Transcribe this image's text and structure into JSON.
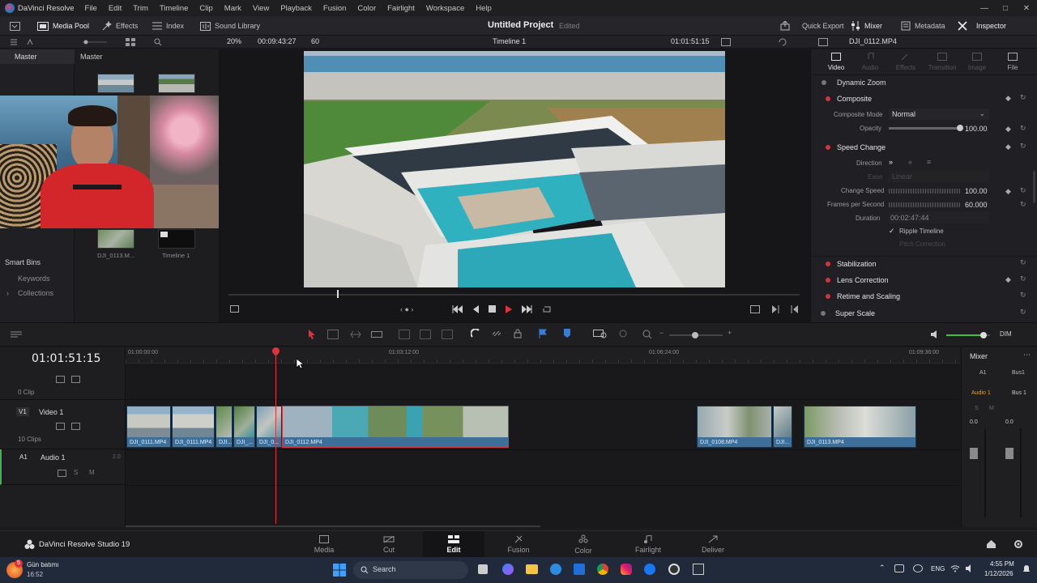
{
  "menubar": {
    "app_name": "DaVinci Resolve",
    "items": [
      "File",
      "Edit",
      "Trim",
      "Timeline",
      "Clip",
      "Mark",
      "View",
      "Playback",
      "Fusion",
      "Color",
      "Fairlight",
      "Workspace",
      "Help"
    ]
  },
  "toolbar": {
    "media_pool": "Media Pool",
    "effects": "Effects",
    "index": "Index",
    "sound_library": "Sound Library",
    "project_title": "Untitled Project",
    "project_status": "Edited",
    "quick_export": "Quick Export",
    "mixer": "Mixer",
    "metadata": "Metadata",
    "inspector": "Inspector"
  },
  "subbar": {
    "zoom": "20%",
    "source_timecode": "00:09:43:27",
    "fps": "60",
    "timeline_name": "Timeline 1",
    "record_timecode": "01:01:51:15",
    "clip_name": "DJI_0112.MP4"
  },
  "media_pool": {
    "bin_master": "Master",
    "header_master": "Master",
    "smart_bins": "Smart Bins",
    "keywords": "Keywords",
    "collections": "Collections",
    "clips": [
      {
        "name": "DJI_0113.M..."
      },
      {
        "name": "Timeline 1"
      }
    ]
  },
  "inspector": {
    "tabs": [
      "Video",
      "Audio",
      "Effects",
      "Transition",
      "Image",
      "File"
    ],
    "dynamic_zoom": "Dynamic Zoom",
    "composite": "Composite",
    "composite_mode_label": "Composite Mode",
    "composite_mode_value": "Normal",
    "opacity_label": "Opacity",
    "opacity_value": "100.00",
    "opacity_level": 1.0,
    "speed_change": "Speed Change",
    "direction_label": "Direction",
    "ease_label": "Ease",
    "ease_value": "Linear",
    "change_speed_label": "Change Speed",
    "change_speed_value": "100.00",
    "fps_label": "Frames per Second",
    "fps_value": "60.000",
    "duration_label": "Duration",
    "duration_value": "00:02:47:44",
    "ripple_timeline": "Ripple Timeline",
    "pitch_correction": "Pitch Correction",
    "stabilization": "Stabilization",
    "lens_correction": "Lens Correction",
    "retime_scaling": "Retime and Scaling",
    "super_scale": "Super Scale"
  },
  "timeline": {
    "timecode": "01:01:51:15",
    "ruler": [
      "01:00:00:00",
      "01:03:12:00",
      "01:06:24:00",
      "01:09:36:00"
    ],
    "track_empty_clips": "0 Clip",
    "v1_id": "V1",
    "v1_name": "Video 1",
    "v1_clips": "10 Clips",
    "a1_id": "A1",
    "a1_name": "Audio 1",
    "a1_level": "2.0",
    "clips": [
      {
        "label": "DJI_0111.MP4"
      },
      {
        "label": "DJI_0111.MP4"
      },
      {
        "label": "DJI..."
      },
      {
        "label": "DJI_..."
      },
      {
        "label": "DJI_0..."
      },
      {
        "label": "DJI_0112.MP4"
      },
      {
        "label": "DJI_0108.MP4"
      },
      {
        "label": "DJI..."
      },
      {
        "label": "DJI_0113.MP4"
      }
    ],
    "dim_label": "DIM",
    "volume_level": 0.85
  },
  "mixer": {
    "title": "Mixer",
    "ch_a1": "A1",
    "ch_bus1": "Bus1",
    "audio1": "Audio 1",
    "bus1": "Bus 1",
    "s": "S",
    "m": "M",
    "db0": "0.0",
    "db1": "0.0"
  },
  "pages": {
    "brand": "DaVinci Resolve Studio 19",
    "items": [
      "Media",
      "Cut",
      "Edit",
      "Fusion",
      "Color",
      "Fairlight",
      "Deliver"
    ],
    "active": "Edit"
  },
  "taskbar": {
    "weather": "Gün batımı",
    "weather_time": "16:52",
    "badge": "5",
    "search": "Search",
    "lang": "ENG",
    "time": "4:55 PM",
    "date": "1/12/2026"
  },
  "colors": {
    "accent_red": "#d4343e",
    "clip_blue": "#3d6f99",
    "playhead": "#e0323c"
  }
}
